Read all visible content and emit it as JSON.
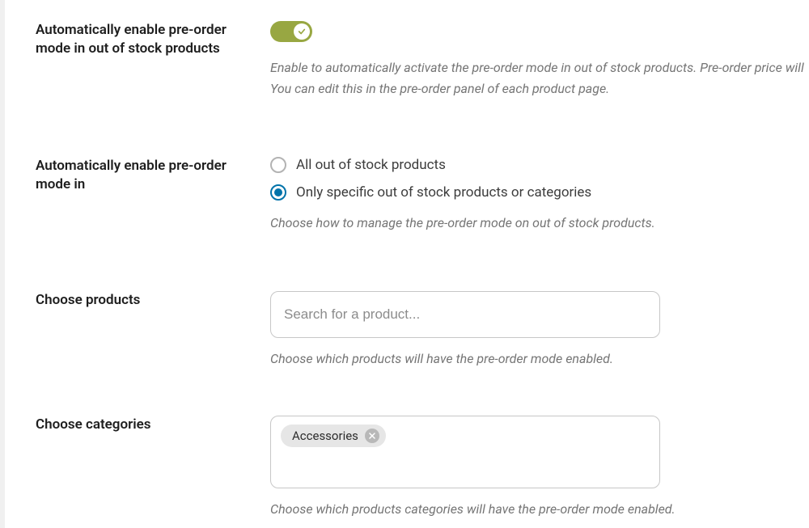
{
  "settings": {
    "auto_enable": {
      "label": "Automatically enable pre-order mode in out of stock products",
      "enabled": true,
      "help_line1": "Enable to automatically activate the pre-order mode in out of stock products. Pre-order price will",
      "help_line2": "You can edit this in the pre-order panel of each product page."
    },
    "mode_in": {
      "label": "Automatically enable pre-order mode in",
      "options": {
        "all": "All out of stock products",
        "specific": "Only specific out of stock products or categories"
      },
      "selected": "specific",
      "help": "Choose how to manage the pre-order mode on out of stock products."
    },
    "products": {
      "label": "Choose products",
      "placeholder": "Search for a product...",
      "help": "Choose which products will have the pre-order mode enabled."
    },
    "categories": {
      "label": "Choose categories",
      "selected": [
        {
          "name": "Accessories"
        }
      ],
      "help": "Choose which products categories will have the pre-order mode enabled."
    }
  }
}
